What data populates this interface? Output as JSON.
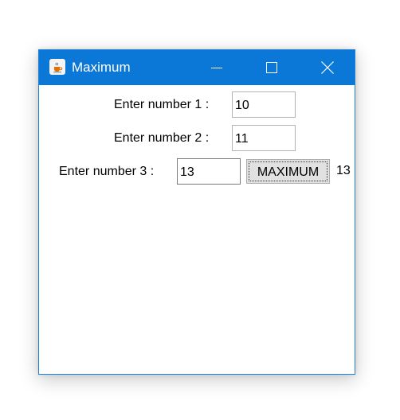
{
  "window": {
    "title": "Maximum",
    "icon": "java-coffee-cup-icon",
    "controls": {
      "minimize_icon": "minimize-icon",
      "maximize_icon": "maximize-icon",
      "close_icon": "close-icon"
    },
    "titlebar_color": "#0b78d7"
  },
  "form": {
    "label1": "Enter number 1 :",
    "value1": "10",
    "label2": "Enter number 2 :",
    "value2": "11",
    "label3": "Enter number 3 :",
    "value3": "13",
    "button_label": "MAXIMUM",
    "result": "13"
  }
}
